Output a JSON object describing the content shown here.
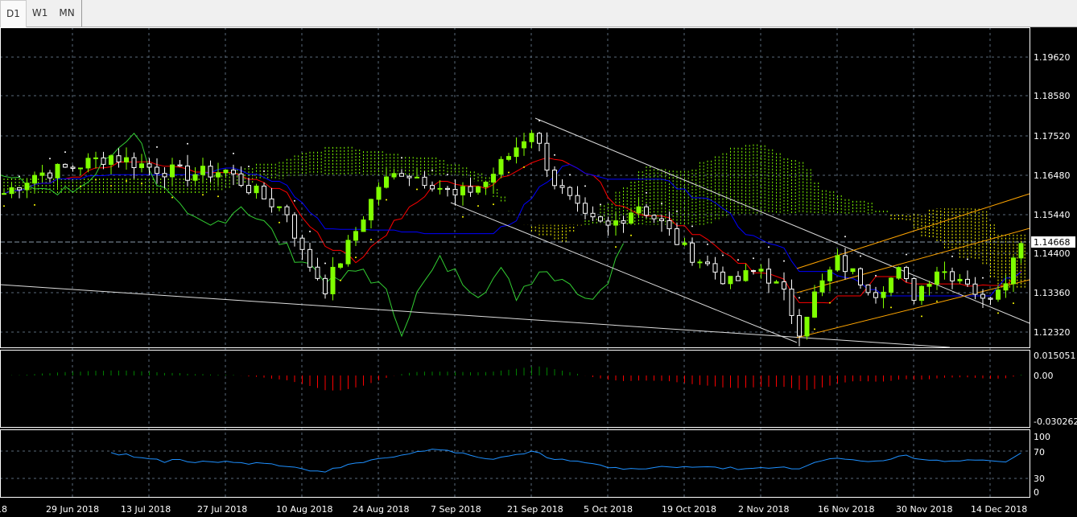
{
  "timeframe_tabs": [
    {
      "label": "D1",
      "active": true
    },
    {
      "label": "W1",
      "active": false
    },
    {
      "label": "MN",
      "active": false
    }
  ],
  "price_axis": {
    "labels": [
      "1.19620",
      "1.18580",
      "1.17520",
      "1.16480",
      "1.15440",
      "1.14400",
      "1.13360",
      "1.12320"
    ],
    "current_price": "1.14668"
  },
  "macd_axis": {
    "labels": [
      "0.015051",
      "0.00",
      "-0.030262"
    ]
  },
  "rsi_axis": {
    "labels": [
      "100",
      "70",
      "30",
      "0"
    ]
  },
  "date_axis": {
    "labels": [
      "18",
      "29 Jun 2018",
      "13 Jul 2018",
      "27 Jul 2018",
      "10 Aug 2018",
      "24 Aug 2018",
      "7 Sep 2018",
      "21 Sep 2018",
      "5 Oct 2018",
      "19 Oct 2018",
      "2 Nov 2018",
      "16 Nov 2018",
      "30 Nov 2018",
      "14 Dec 2018"
    ]
  },
  "colors": {
    "bull": "#7fff00",
    "bear": "#ffffff",
    "grid": "#5a6a7a",
    "cloud": "#7fff00",
    "cloud2": "#ffff00",
    "tenkan": "#ff0000",
    "kijun": "#0000ff",
    "chikou": "#32cd32",
    "macd_up": "#008000",
    "macd_down": "#ff0000",
    "rsi": "#1e90ff",
    "channel": "#ffa500"
  },
  "chart_data": {
    "type": "candlestick",
    "symbol_price_path": [
      [
        0,
        1.16
      ],
      [
        4,
        1.165
      ],
      [
        9,
        1.167
      ],
      [
        14,
        1.17
      ],
      [
        19,
        1.167
      ],
      [
        24,
        1.165
      ],
      [
        29,
        1.166
      ],
      [
        33,
        1.16
      ],
      [
        37,
        1.155
      ],
      [
        39,
        1.144
      ],
      [
        42,
        1.135
      ],
      [
        45,
        1.146
      ],
      [
        49,
        1.162
      ],
      [
        52,
        1.166
      ],
      [
        56,
        1.163
      ],
      [
        59,
        1.159
      ],
      [
        63,
        1.163
      ],
      [
        66,
        1.17
      ],
      [
        69,
        1.177
      ],
      [
        72,
        1.163
      ],
      [
        76,
        1.153
      ],
      [
        79,
        1.151
      ],
      [
        83,
        1.157
      ],
      [
        86,
        1.152
      ],
      [
        89,
        1.145
      ],
      [
        92,
        1.141
      ],
      [
        95,
        1.136
      ],
      [
        99,
        1.14
      ],
      [
        102,
        1.133
      ],
      [
        104,
        1.124
      ],
      [
        106,
        1.133
      ],
      [
        109,
        1.142
      ],
      [
        112,
        1.137
      ],
      [
        114,
        1.134
      ],
      [
        117,
        1.139
      ],
      [
        119,
        1.133
      ],
      [
        122,
        1.14
      ],
      [
        126,
        1.137
      ],
      [
        128,
        1.131
      ],
      [
        131,
        1.138
      ],
      [
        133,
        1.1467
      ]
    ]
  }
}
